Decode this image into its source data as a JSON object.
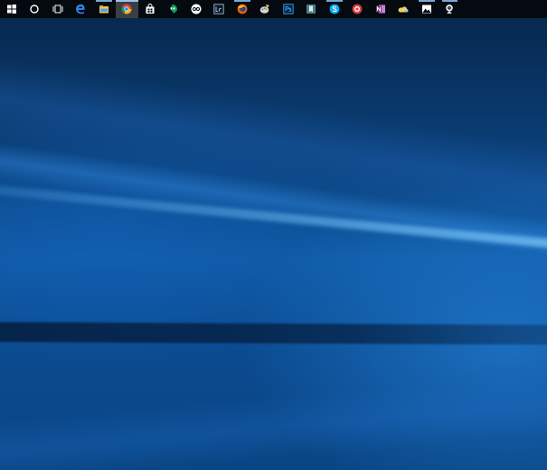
{
  "taskbar": {
    "items": [
      {
        "icon": "windows-start-icon",
        "running": false,
        "active": false
      },
      {
        "icon": "cortana-search-icon",
        "running": false,
        "active": false
      },
      {
        "icon": "task-view-icon",
        "running": false,
        "active": false
      },
      {
        "icon": "edge-browser-icon",
        "running": false,
        "active": false
      },
      {
        "icon": "file-explorer-icon",
        "running": true,
        "active": false
      },
      {
        "icon": "chrome-icon",
        "running": true,
        "active": true
      },
      {
        "icon": "store-icon",
        "running": false,
        "active": false
      },
      {
        "icon": "hangouts-icon",
        "running": false,
        "active": false
      },
      {
        "icon": "gopro-icon",
        "running": false,
        "active": false
      },
      {
        "icon": "lightroom-icon",
        "running": false,
        "active": false
      },
      {
        "icon": "firefox-icon",
        "running": true,
        "active": false
      },
      {
        "icon": "paint-icon",
        "running": false,
        "active": false
      },
      {
        "icon": "photoshop-icon",
        "running": false,
        "active": false
      },
      {
        "icon": "bookmark-app-icon",
        "running": false,
        "active": false
      },
      {
        "icon": "skype-icon",
        "running": true,
        "active": false
      },
      {
        "icon": "record-app-icon",
        "running": false,
        "active": false
      },
      {
        "icon": "onenote-icon",
        "running": false,
        "active": false
      },
      {
        "icon": "onedrive-icon",
        "running": false,
        "active": false
      },
      {
        "icon": "photos-icon",
        "running": true,
        "active": false
      },
      {
        "icon": "webcam-icon",
        "running": true,
        "active": false
      }
    ],
    "colors": {
      "background": "#050a11",
      "active": "#3a3f46",
      "indicator": "#7aa7d6"
    }
  },
  "desktop": {
    "wallpaper": "windows-10-hero-blue",
    "accent": "#0f5aa6"
  }
}
